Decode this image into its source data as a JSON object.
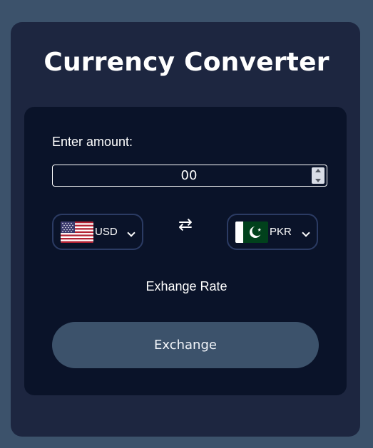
{
  "app": {
    "title": "Currency Converter"
  },
  "amount": {
    "label": "Enter amount:",
    "value": "00",
    "placeholder": ""
  },
  "from": {
    "currency": "USD",
    "flag_icon": "us-flag-icon"
  },
  "to": {
    "currency": "PKR",
    "flag_icon": "pk-flag-icon"
  },
  "swap_icon": "⇄",
  "exchange_rate_label": "Exhange Rate",
  "exchange_button_label": "Exchange",
  "colors": {
    "background": "#3c526b",
    "card": "#1d2640",
    "panel": "#0a1329",
    "accent_button": "#3c526b"
  }
}
